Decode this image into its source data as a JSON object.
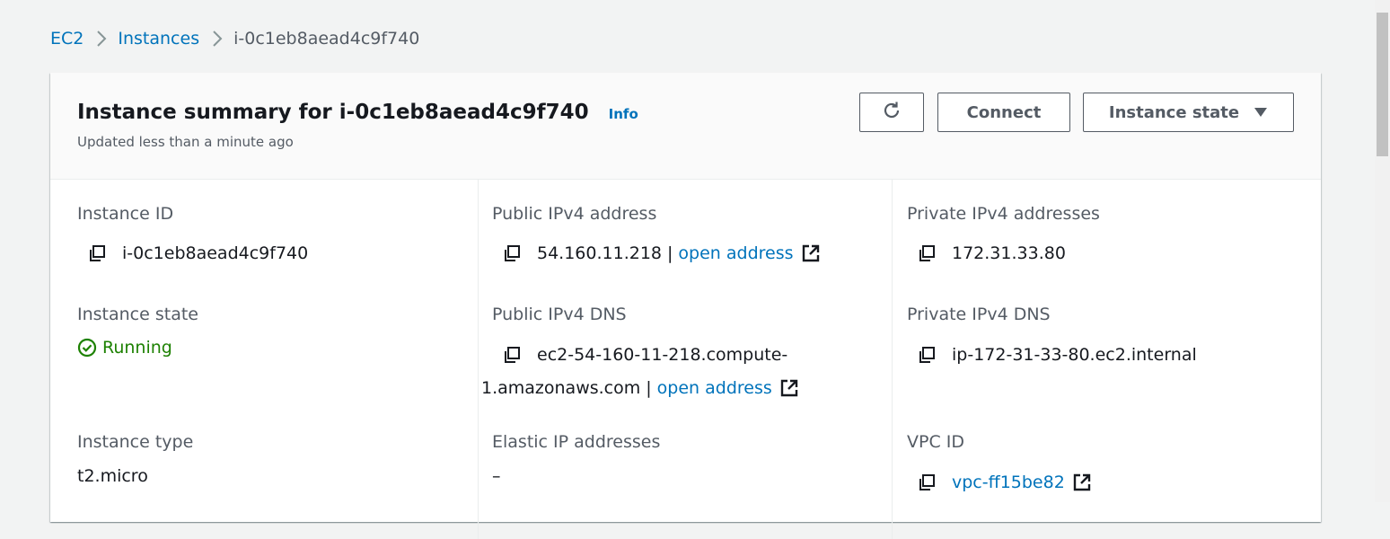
{
  "breadcrumb": {
    "items": [
      {
        "label": "EC2"
      },
      {
        "label": "Instances"
      },
      {
        "label": "i-0c1eb8aead4c9f740"
      }
    ]
  },
  "header": {
    "title": "Instance summary for i-0c1eb8aead4c9f740",
    "info_label": "Info",
    "subtitle": "Updated less than a minute ago",
    "buttons": {
      "refresh_icon": "refresh-icon",
      "connect_label": "Connect",
      "instance_state_label": "Instance state"
    }
  },
  "details": {
    "instance_id": {
      "label": "Instance ID",
      "value": "i-0c1eb8aead4c9f740"
    },
    "public_ipv4": {
      "label": "Public IPv4 address",
      "value": "54.160.11.218",
      "separator": "|",
      "link": "open address"
    },
    "private_ipv4": {
      "label": "Private IPv4 addresses",
      "value": "172.31.33.80"
    },
    "instance_state": {
      "label": "Instance state",
      "value": "Running"
    },
    "public_dns": {
      "label": "Public IPv4 DNS",
      "value_line1": "ec2-54-160-11-218.compute-",
      "value_line2": "1.amazonaws.com",
      "separator": "|",
      "link": "open address"
    },
    "private_dns": {
      "label": "Private IPv4 DNS",
      "value": "ip-172-31-33-80.ec2.internal"
    },
    "instance_type": {
      "label": "Instance type",
      "value": "t2.micro"
    },
    "elastic_ip": {
      "label": "Elastic IP addresses",
      "value": "–"
    },
    "vpc_id": {
      "label": "VPC ID",
      "value": "vpc-ff15be82"
    }
  },
  "colors": {
    "link": "#0073bb",
    "success": "#1d8102",
    "text": "#16191f",
    "muted": "#545b64",
    "background": "#f2f3f3"
  }
}
